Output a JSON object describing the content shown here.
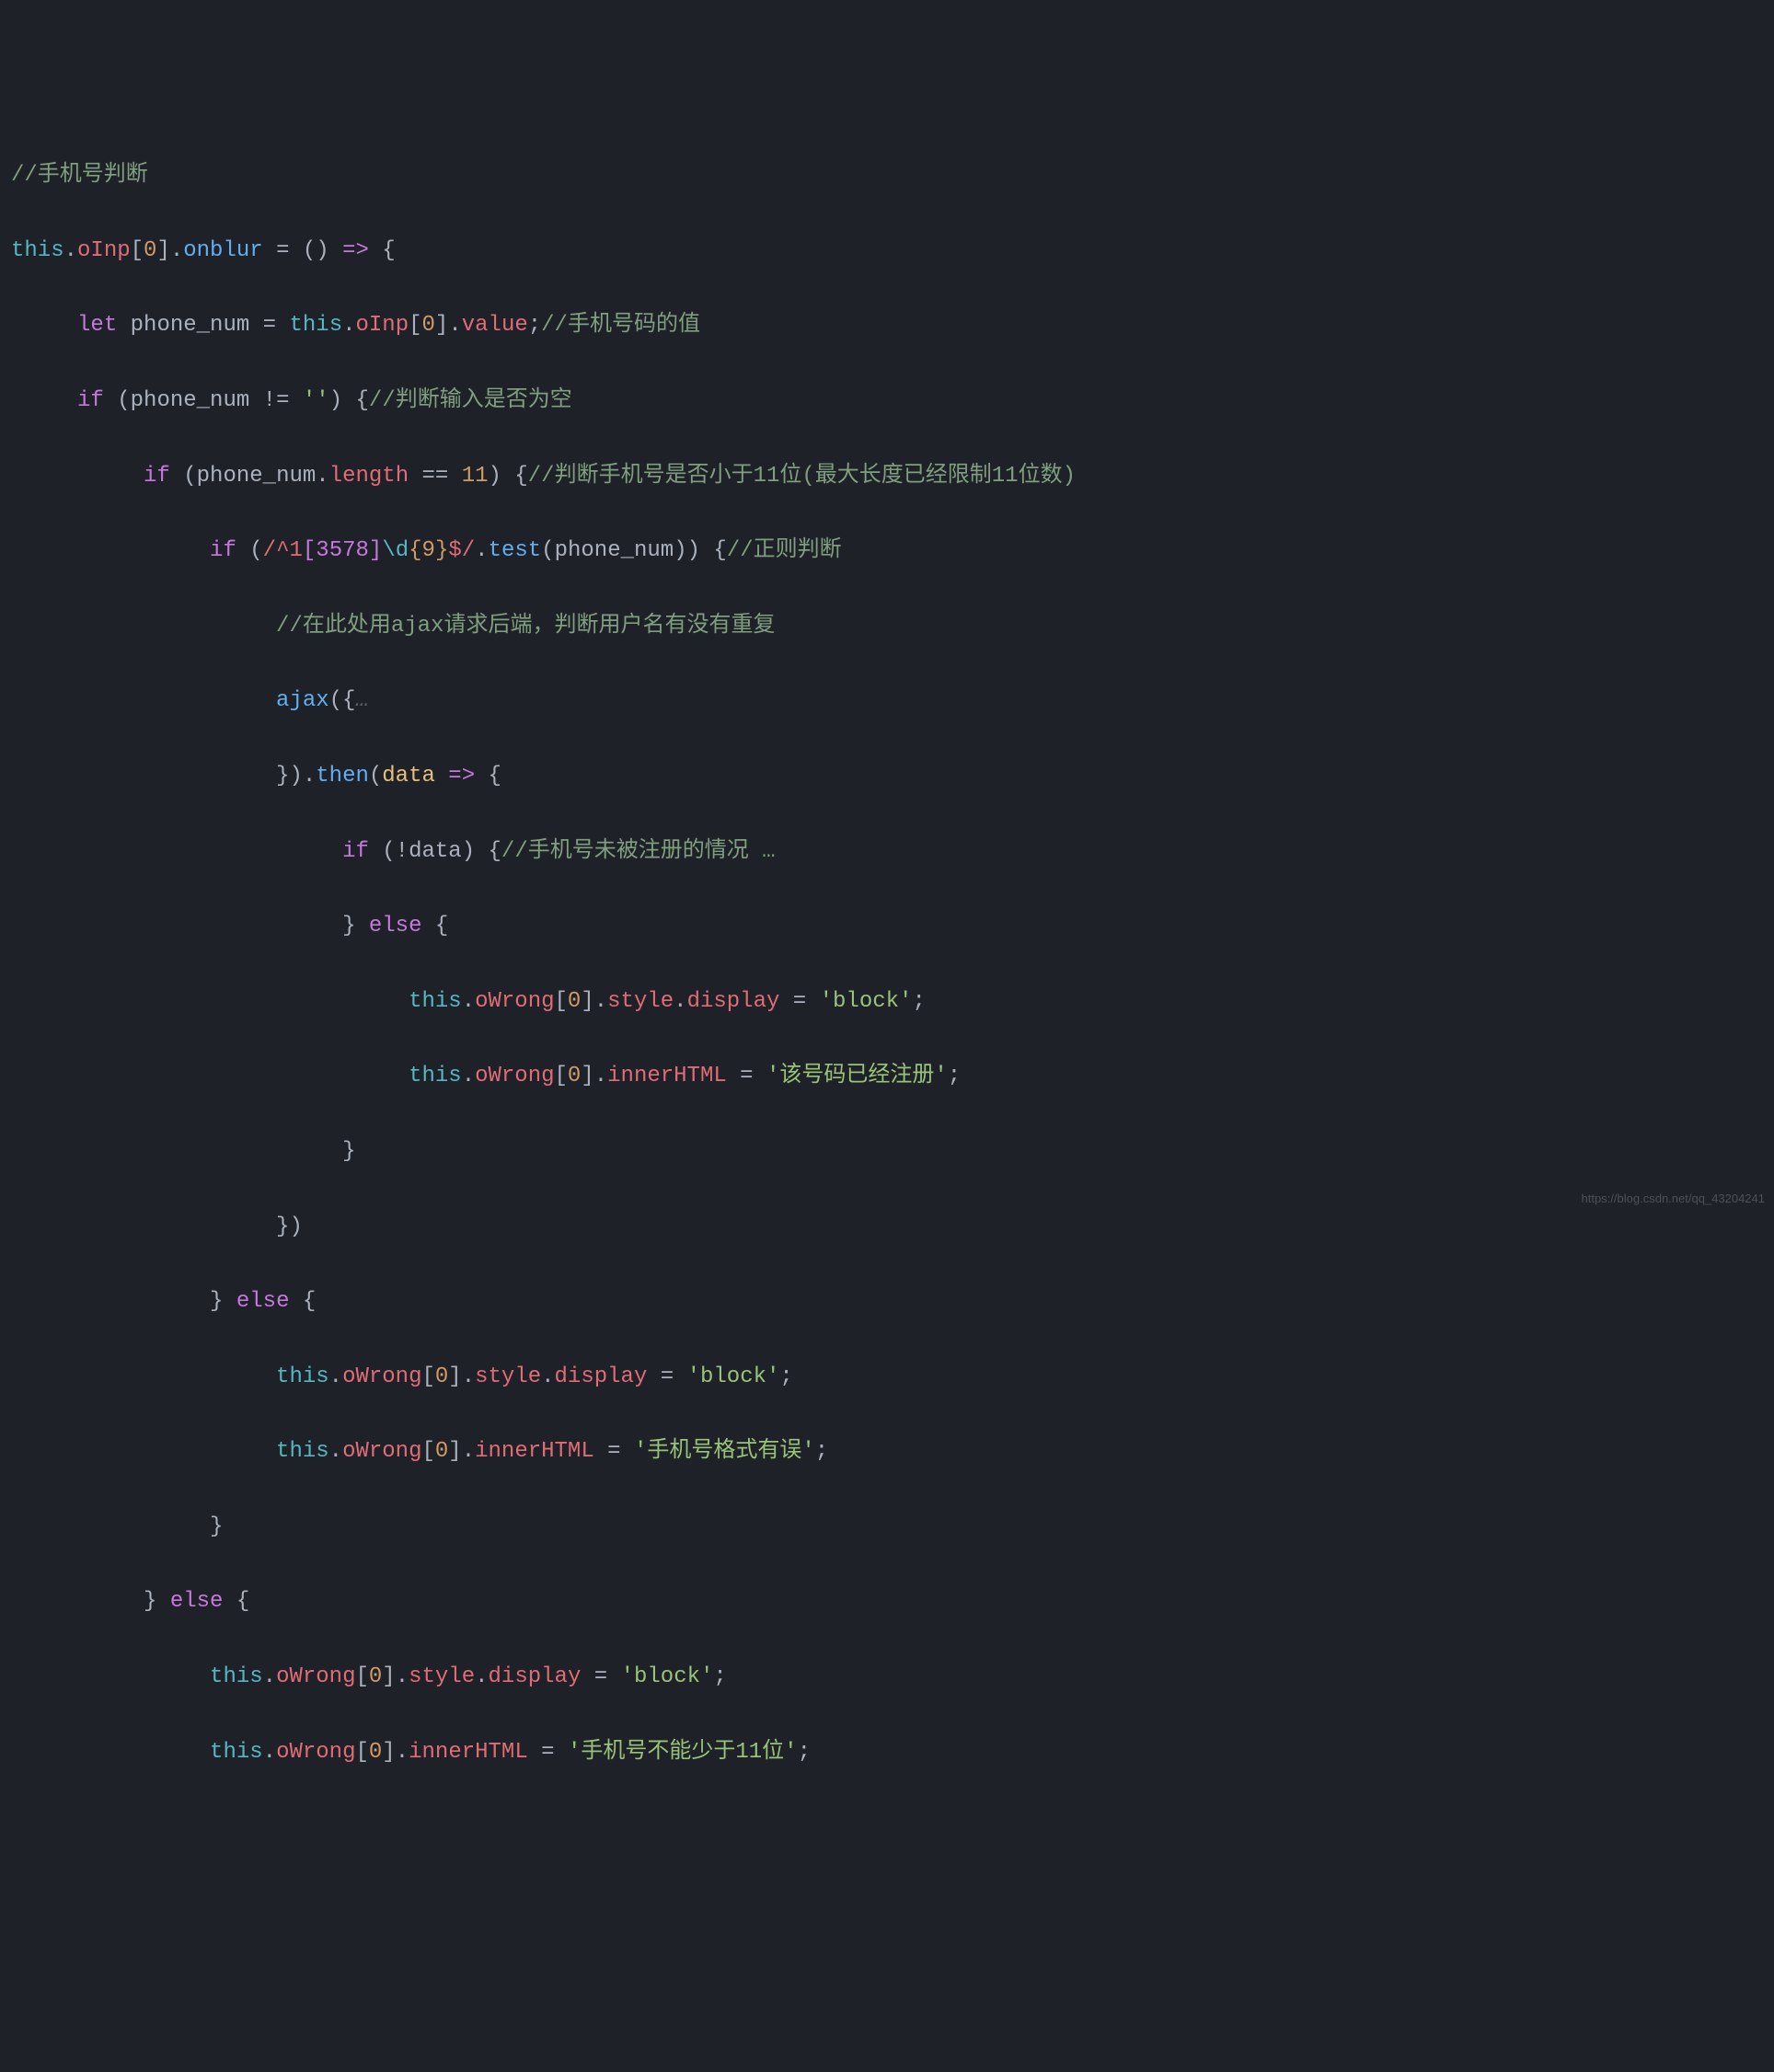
{
  "watermark": "https://blog.csdn.net/qq_43204241",
  "code": {
    "c01": "//手机号判断",
    "c02": "//手机号码的值",
    "c03": "//判断输入是否为空",
    "c04": "//判断手机号是否小于11位(最大长度已经限制11位数)",
    "c05": "//正则判断",
    "c06": "//在此处用ajax请求后端，判断用户名有没有重复",
    "c07": "//手机号未被注册的情况 …",
    "kw_this": "this",
    "kw_let": "let",
    "kw_if": "if",
    "kw_else": "else",
    "eq_arrow": "=>",
    "dots": "…",
    "prop_oInp": "oInp",
    "prop_onblur": "onblur",
    "prop_value": "value",
    "prop_length": "length",
    "prop_oWrong": "oWrong",
    "prop_style": "style",
    "prop_display": "display",
    "prop_innerHTML": "innerHTML",
    "m_test": "test",
    "m_ajax": "ajax",
    "m_then": "then",
    "var_phone": "phone_num",
    "param_data": "data",
    "idx0": "0",
    "n11": "11",
    "s_empty": "''",
    "s_block": "'block'",
    "s_reg_already": "'该号码已经注册'",
    "s_fmt_err": "'手机号格式有误'",
    "s_too_short": "'手机号不能少于11位'",
    "rgx": {
      "open": "/",
      "anchor1": "^",
      "lit1": "1",
      "cls": "[3578]",
      "esc": "\\d",
      "q_open": "{",
      "q_n": "9",
      "q_close": "}",
      "anchor2": "$",
      "close": "/"
    }
  }
}
